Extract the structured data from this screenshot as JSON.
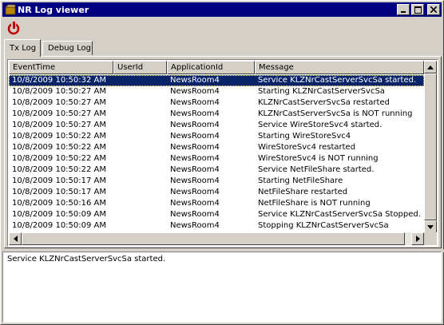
{
  "window": {
    "title": "NR Log viewer"
  },
  "toolbar": {
    "refresh_icon": "red-circle-arrow-icon"
  },
  "tabs": [
    {
      "label": "Tx Log",
      "active": true
    },
    {
      "label": "Debug Log",
      "active": false
    }
  ],
  "table": {
    "columns": [
      "EventTime",
      "UserId",
      "ApplicationId",
      "Message"
    ],
    "rows": [
      {
        "time": "10/8/2009 10:50:32 AM",
        "user": "",
        "app": "NewsRoom4",
        "message": "Service KLZNrCastServerSvcSa started.",
        "selected": true
      },
      {
        "time": "10/8/2009 10:50:27 AM",
        "user": "",
        "app": "NewsRoom4",
        "message": "Starting KLZNrCastServerSvcSa"
      },
      {
        "time": "10/8/2009 10:50:27 AM",
        "user": "",
        "app": "NewsRoom4",
        "message": "KLZNrCastServerSvcSa restarted"
      },
      {
        "time": "10/8/2009 10:50:27 AM",
        "user": "",
        "app": "NewsRoom4",
        "message": "KLZNrCastServerSvcSa is NOT running"
      },
      {
        "time": "10/8/2009 10:50:27 AM",
        "user": "",
        "app": "NewsRoom4",
        "message": "Service WireStoreSvc4 started."
      },
      {
        "time": "10/8/2009 10:50:22 AM",
        "user": "",
        "app": "NewsRoom4",
        "message": "Starting WireStoreSvc4"
      },
      {
        "time": "10/8/2009 10:50:22 AM",
        "user": "",
        "app": "NewsRoom4",
        "message": "WireStoreSvc4 restarted"
      },
      {
        "time": "10/8/2009 10:50:22 AM",
        "user": "",
        "app": "NewsRoom4",
        "message": "WireStoreSvc4 is NOT running"
      },
      {
        "time": "10/8/2009 10:50:22 AM",
        "user": "",
        "app": "NewsRoom4",
        "message": "Service NetFileShare started."
      },
      {
        "time": "10/8/2009 10:50:17 AM",
        "user": "",
        "app": "NewsRoom4",
        "message": "Starting NetFileShare"
      },
      {
        "time": "10/8/2009 10:50:17 AM",
        "user": "",
        "app": "NewsRoom4",
        "message": "NetFileShare restarted"
      },
      {
        "time": "10/8/2009 10:50:16 AM",
        "user": "",
        "app": "NewsRoom4",
        "message": "NetFileShare is NOT running"
      },
      {
        "time": "10/8/2009 10:50:09 AM",
        "user": "",
        "app": "NewsRoom4",
        "message": "Service KLZNrCastServerSvcSa Stopped."
      },
      {
        "time": "10/8/2009 10:50:09 AM",
        "user": "",
        "app": "NewsRoom4",
        "message": "Stopping KLZNrCastServerSvcSa"
      }
    ]
  },
  "detail": {
    "text": "Service KLZNrCastServerSvcSa started."
  },
  "colors": {
    "title_bar": "#000080",
    "selection": "#0a246a",
    "face": "#d4d0c8"
  }
}
